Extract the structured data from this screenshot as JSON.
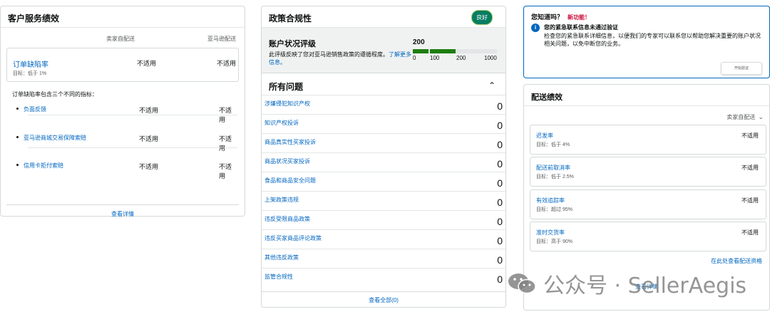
{
  "customer_service": {
    "title": "客户服务绩效",
    "col_seller": "卖家自配送",
    "col_amazon": "亚马逊配送",
    "odr": {
      "label": "订单缺陷率",
      "target": "目标：低于 1%",
      "seller_value": "不适用",
      "amazon_value": "不适用"
    },
    "intro": "订单缺陷率包含三个不同的指标：",
    "metrics": [
      {
        "label": "负面反馈",
        "seller_value": "不适用",
        "amazon_value": "不适用"
      },
      {
        "label": "亚马逊商城交易保障索赔",
        "seller_value": "不适用",
        "amazon_value": "不适用"
      },
      {
        "label": "信用卡拒付索赔",
        "seller_value": "不适用",
        "amazon_value": "不适用"
      }
    ],
    "view_details": "查看详情"
  },
  "policy": {
    "title": "政策合规性",
    "badge": "良好",
    "ahr": {
      "title": "账户状况评级",
      "desc": "此评级反映了您对亚马逊销售政策的遵循程度。",
      "learn_more": "了解更多信息。",
      "score": "200",
      "scale": [
        "0",
        "100",
        "200",
        "1000"
      ],
      "bar_colors": {
        "good": "#1e7e0e",
        "track": "#e3e6e6"
      }
    },
    "issues_title": "所有问题",
    "issues": [
      {
        "label": "涉嫌侵犯知识产权",
        "count": "0"
      },
      {
        "label": "知识产权投诉",
        "count": "0"
      },
      {
        "label": "商品真实性买家投诉",
        "count": "0"
      },
      {
        "label": "商品状况买家投诉",
        "count": "0"
      },
      {
        "label": "食品和商品安全问题",
        "count": "0"
      },
      {
        "label": "上架政策违规",
        "count": "0"
      },
      {
        "label": "违反受限商品政策",
        "count": "0"
      },
      {
        "label": "违反买家商品评论政策",
        "count": "0"
      },
      {
        "label": "其他违反政策",
        "count": "0"
      },
      {
        "label": "监管合规性",
        "count": "0"
      }
    ],
    "view_all": "查看全部(0)"
  },
  "did_you_know": {
    "title": "您知道吗？",
    "new_label": "新功能！",
    "headline": "您的紧急联系信息未通过验证",
    "desc": "检查您的紧急联系详细信息，以便我们的专家可以联系您以帮助您解决重要的账户状况相关问题，以免中断您的业务。",
    "button": "开始验证"
  },
  "shipping": {
    "title": "配送绩效",
    "fulfillment": "卖家自配送",
    "metrics": [
      {
        "label": "迟发率",
        "target": "目标：低于 4%",
        "value": "不适用"
      },
      {
        "label": "配送前取消率",
        "target": "目标：低于 2.5%",
        "value": "不适用"
      },
      {
        "label": "有效追踪率",
        "target": "目标：超过 95%",
        "value": "不适用"
      },
      {
        "label": "准时交货率",
        "target": "目标：高于 90%",
        "value": "不适用"
      }
    ],
    "eligibility": "在此处查看配送资格",
    "view_details": "查看详情"
  },
  "watermark": {
    "text": "公众号 · SellerAegis"
  }
}
